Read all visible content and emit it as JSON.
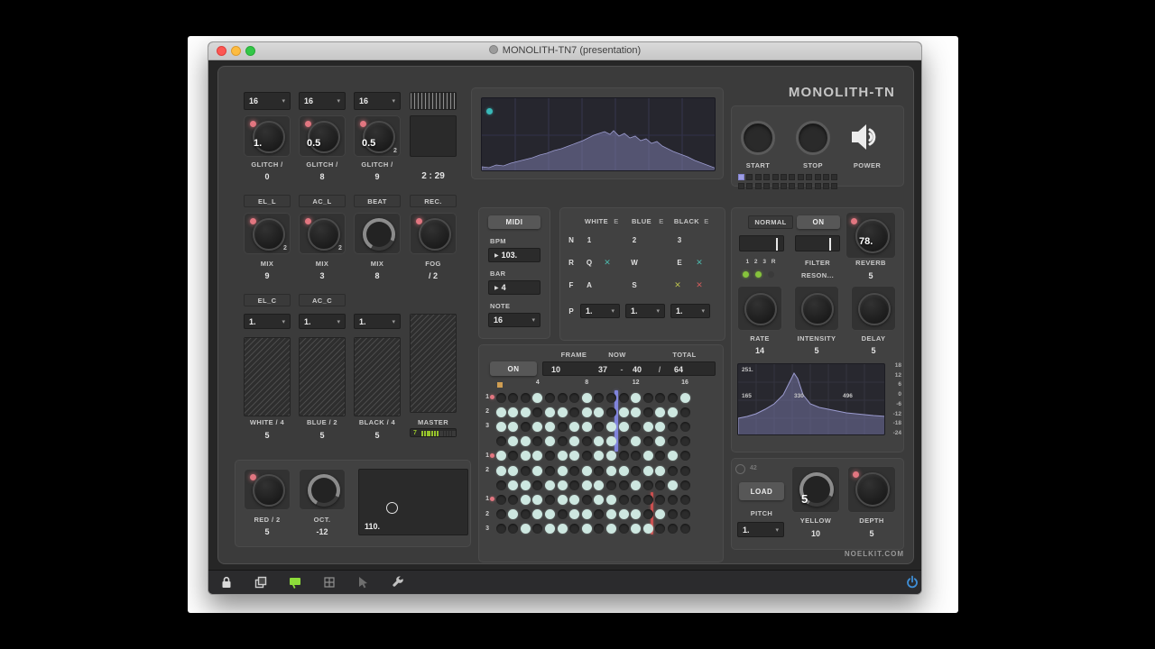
{
  "icons": {
    "chevron": "▾",
    "play": "▶",
    "x": "✕"
  },
  "window": {
    "title": "MONOLITH-TN7 (presentation)",
    "brand": "MONOLITH-TN",
    "footer": "NOELKIT.COM"
  },
  "glitch": {
    "selects": [
      "16",
      "16",
      "16"
    ],
    "clock": "2 : 29",
    "knobs": [
      {
        "value": "1.",
        "label": "GLITCH /",
        "num": "0",
        "sub": ""
      },
      {
        "value": "0.5",
        "label": "GLITCH /",
        "num": "8",
        "sub": ""
      },
      {
        "value": "0.5",
        "label": "GLITCH /",
        "num": "9",
        "sub": "2"
      }
    ]
  },
  "tracks": [
    "EL_L",
    "AC_L",
    "BEAT",
    "REC."
  ],
  "mix": [
    {
      "label": "MIX",
      "num": "9",
      "sub": "2"
    },
    {
      "label": "MIX",
      "num": "3",
      "sub": "2"
    },
    {
      "label": "MIX",
      "num": "8",
      "sub": ""
    },
    {
      "label": "FOG",
      "num": "/ 2",
      "sub": ""
    }
  ],
  "chans": [
    "EL_C",
    "AC_C"
  ],
  "minisel": [
    "1.",
    "1.",
    "1."
  ],
  "faders": [
    {
      "label": "WHITE / 4",
      "num": "5"
    },
    {
      "label": "BLUE / 2",
      "num": "5"
    },
    {
      "label": "BLACK / 4",
      "num": "5"
    }
  ],
  "master": {
    "label": "MASTER",
    "value": 7,
    "segments": 14,
    "value_text": "7"
  },
  "bottom": {
    "red": {
      "label": "RED / 2",
      "num": "5"
    },
    "oct": {
      "label": "OCT.",
      "num": "-12"
    },
    "tuner": "110."
  },
  "transport": {
    "start": "START",
    "stop": "STOP",
    "power": "POWER",
    "rows": 2,
    "steps_per_row": 12,
    "active": 0
  },
  "midi": {
    "title": "MIDI",
    "bpm_label": "BPM",
    "bpm": "103.",
    "bar_label": "BAR",
    "bar": "4",
    "note_label": "NOTE",
    "note": "16"
  },
  "matrix": {
    "headers": [
      {
        "name": "WHITE",
        "e": "E"
      },
      {
        "name": "BLUE",
        "e": "E"
      },
      {
        "name": "BLACK",
        "e": "E"
      }
    ],
    "key_n": "N",
    "key_r": "R",
    "key_f": "F",
    "key_p": "P",
    "n1": "1",
    "n2": "2",
    "n3": "3",
    "r1": "Q",
    "r2": "W",
    "r3": "E",
    "f1": "A",
    "f2": "S",
    "p": [
      "1.",
      "1.",
      "1."
    ]
  },
  "fx": {
    "normal": "NORMAL",
    "on": "ON",
    "steps": "1 2 3 R",
    "filter": "FILTER",
    "reson": "RESON...",
    "reverb": {
      "value": "78.",
      "label": "REVERB",
      "num": "5"
    },
    "knobs": [
      {
        "label": "RATE",
        "num": "14"
      },
      {
        "label": "INTENSITY",
        "num": "5"
      },
      {
        "label": "DELAY",
        "num": "5"
      }
    ],
    "graph": {
      "peak": "251.",
      "f1": "165",
      "f2": "330",
      "f3": "496",
      "scale": [
        "18",
        "12",
        "6",
        "0",
        "-6",
        "-12",
        "-18",
        "-24"
      ]
    }
  },
  "seq": {
    "on": "ON",
    "frame_label": "FRAME",
    "frame": "10",
    "now_label": "NOW",
    "now_a": "37",
    "now_sep": "-",
    "now_b": "40",
    "slash": "/",
    "total_label": "TOTAL",
    "total": "64",
    "col_numbers": [
      "4",
      "8",
      "12",
      "16"
    ],
    "row_labels": [
      "1",
      "2",
      "3",
      "",
      "1",
      "2",
      "",
      "1",
      "2",
      "3"
    ],
    "led_rows": [
      0,
      4,
      7
    ],
    "grid": [
      [
        0,
        0,
        0,
        1,
        0,
        0,
        0,
        1,
        0,
        0,
        0,
        1,
        0,
        0,
        0,
        1
      ],
      [
        1,
        1,
        1,
        0,
        1,
        1,
        0,
        1,
        1,
        0,
        1,
        1,
        0,
        1,
        1,
        0
      ],
      [
        1,
        1,
        0,
        1,
        1,
        0,
        1,
        1,
        0,
        1,
        1,
        0,
        1,
        1,
        0,
        0
      ],
      [
        0,
        1,
        1,
        0,
        1,
        0,
        1,
        0,
        1,
        1,
        0,
        1,
        0,
        1,
        0,
        0
      ],
      [
        1,
        0,
        1,
        1,
        0,
        1,
        1,
        0,
        1,
        1,
        0,
        0,
        1,
        0,
        1,
        0
      ],
      [
        1,
        1,
        0,
        1,
        0,
        1,
        0,
        1,
        0,
        1,
        1,
        0,
        1,
        1,
        0,
        0
      ],
      [
        0,
        1,
        1,
        0,
        1,
        1,
        0,
        1,
        1,
        0,
        0,
        1,
        0,
        0,
        1,
        0
      ],
      [
        0,
        0,
        1,
        1,
        0,
        1,
        1,
        0,
        1,
        1,
        0,
        0,
        0,
        0,
        0,
        0
      ],
      [
        0,
        1,
        0,
        1,
        1,
        0,
        1,
        1,
        0,
        1,
        1,
        1,
        0,
        1,
        0,
        0
      ],
      [
        0,
        0,
        1,
        0,
        1,
        1,
        0,
        1,
        0,
        1,
        0,
        1,
        1,
        0,
        0,
        0
      ]
    ]
  },
  "loader": {
    "faint": "42",
    "load": "LOAD",
    "pitch_label": "PITCH",
    "pitch": "1.",
    "yellow": {
      "value": "5",
      "label": "YELLOW",
      "num": "10"
    },
    "depth": {
      "label": "DEPTH",
      "num": "5"
    }
  },
  "colors": {
    "accent_green": "#8ddc3a",
    "led_red": "#e27680",
    "dot_on": "#cde7e0",
    "playhead": "#8084dc",
    "redline": "#c94f4f",
    "power_blue": "#3f8fd8"
  }
}
